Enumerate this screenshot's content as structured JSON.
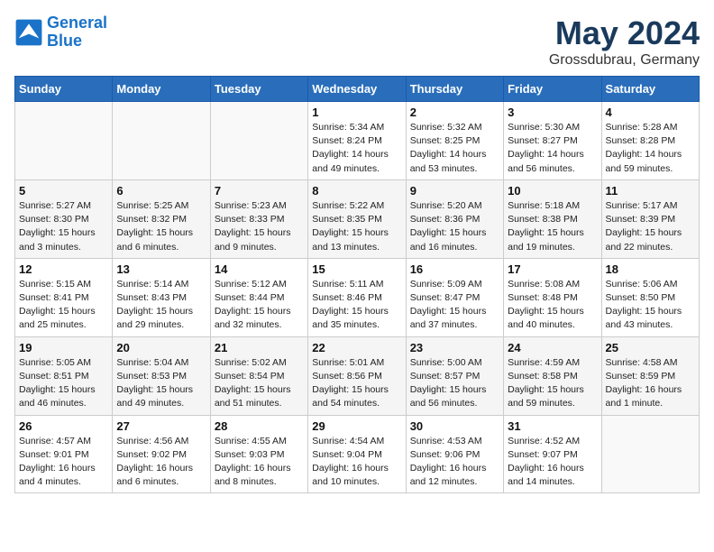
{
  "header": {
    "logo_line1": "General",
    "logo_line2": "Blue",
    "month_title": "May 2024",
    "subtitle": "Grossdubrau, Germany"
  },
  "days_of_week": [
    "Sunday",
    "Monday",
    "Tuesday",
    "Wednesday",
    "Thursday",
    "Friday",
    "Saturday"
  ],
  "weeks": [
    [
      {
        "day": "",
        "info": ""
      },
      {
        "day": "",
        "info": ""
      },
      {
        "day": "",
        "info": ""
      },
      {
        "day": "1",
        "info": "Sunrise: 5:34 AM\nSunset: 8:24 PM\nDaylight: 14 hours\nand 49 minutes."
      },
      {
        "day": "2",
        "info": "Sunrise: 5:32 AM\nSunset: 8:25 PM\nDaylight: 14 hours\nand 53 minutes."
      },
      {
        "day": "3",
        "info": "Sunrise: 5:30 AM\nSunset: 8:27 PM\nDaylight: 14 hours\nand 56 minutes."
      },
      {
        "day": "4",
        "info": "Sunrise: 5:28 AM\nSunset: 8:28 PM\nDaylight: 14 hours\nand 59 minutes."
      }
    ],
    [
      {
        "day": "5",
        "info": "Sunrise: 5:27 AM\nSunset: 8:30 PM\nDaylight: 15 hours\nand 3 minutes."
      },
      {
        "day": "6",
        "info": "Sunrise: 5:25 AM\nSunset: 8:32 PM\nDaylight: 15 hours\nand 6 minutes."
      },
      {
        "day": "7",
        "info": "Sunrise: 5:23 AM\nSunset: 8:33 PM\nDaylight: 15 hours\nand 9 minutes."
      },
      {
        "day": "8",
        "info": "Sunrise: 5:22 AM\nSunset: 8:35 PM\nDaylight: 15 hours\nand 13 minutes."
      },
      {
        "day": "9",
        "info": "Sunrise: 5:20 AM\nSunset: 8:36 PM\nDaylight: 15 hours\nand 16 minutes."
      },
      {
        "day": "10",
        "info": "Sunrise: 5:18 AM\nSunset: 8:38 PM\nDaylight: 15 hours\nand 19 minutes."
      },
      {
        "day": "11",
        "info": "Sunrise: 5:17 AM\nSunset: 8:39 PM\nDaylight: 15 hours\nand 22 minutes."
      }
    ],
    [
      {
        "day": "12",
        "info": "Sunrise: 5:15 AM\nSunset: 8:41 PM\nDaylight: 15 hours\nand 25 minutes."
      },
      {
        "day": "13",
        "info": "Sunrise: 5:14 AM\nSunset: 8:43 PM\nDaylight: 15 hours\nand 29 minutes."
      },
      {
        "day": "14",
        "info": "Sunrise: 5:12 AM\nSunset: 8:44 PM\nDaylight: 15 hours\nand 32 minutes."
      },
      {
        "day": "15",
        "info": "Sunrise: 5:11 AM\nSunset: 8:46 PM\nDaylight: 15 hours\nand 35 minutes."
      },
      {
        "day": "16",
        "info": "Sunrise: 5:09 AM\nSunset: 8:47 PM\nDaylight: 15 hours\nand 37 minutes."
      },
      {
        "day": "17",
        "info": "Sunrise: 5:08 AM\nSunset: 8:48 PM\nDaylight: 15 hours\nand 40 minutes."
      },
      {
        "day": "18",
        "info": "Sunrise: 5:06 AM\nSunset: 8:50 PM\nDaylight: 15 hours\nand 43 minutes."
      }
    ],
    [
      {
        "day": "19",
        "info": "Sunrise: 5:05 AM\nSunset: 8:51 PM\nDaylight: 15 hours\nand 46 minutes."
      },
      {
        "day": "20",
        "info": "Sunrise: 5:04 AM\nSunset: 8:53 PM\nDaylight: 15 hours\nand 49 minutes."
      },
      {
        "day": "21",
        "info": "Sunrise: 5:02 AM\nSunset: 8:54 PM\nDaylight: 15 hours\nand 51 minutes."
      },
      {
        "day": "22",
        "info": "Sunrise: 5:01 AM\nSunset: 8:56 PM\nDaylight: 15 hours\nand 54 minutes."
      },
      {
        "day": "23",
        "info": "Sunrise: 5:00 AM\nSunset: 8:57 PM\nDaylight: 15 hours\nand 56 minutes."
      },
      {
        "day": "24",
        "info": "Sunrise: 4:59 AM\nSunset: 8:58 PM\nDaylight: 15 hours\nand 59 minutes."
      },
      {
        "day": "25",
        "info": "Sunrise: 4:58 AM\nSunset: 8:59 PM\nDaylight: 16 hours\nand 1 minute."
      }
    ],
    [
      {
        "day": "26",
        "info": "Sunrise: 4:57 AM\nSunset: 9:01 PM\nDaylight: 16 hours\nand 4 minutes."
      },
      {
        "day": "27",
        "info": "Sunrise: 4:56 AM\nSunset: 9:02 PM\nDaylight: 16 hours\nand 6 minutes."
      },
      {
        "day": "28",
        "info": "Sunrise: 4:55 AM\nSunset: 9:03 PM\nDaylight: 16 hours\nand 8 minutes."
      },
      {
        "day": "29",
        "info": "Sunrise: 4:54 AM\nSunset: 9:04 PM\nDaylight: 16 hours\nand 10 minutes."
      },
      {
        "day": "30",
        "info": "Sunrise: 4:53 AM\nSunset: 9:06 PM\nDaylight: 16 hours\nand 12 minutes."
      },
      {
        "day": "31",
        "info": "Sunrise: 4:52 AM\nSunset: 9:07 PM\nDaylight: 16 hours\nand 14 minutes."
      },
      {
        "day": "",
        "info": ""
      }
    ]
  ]
}
